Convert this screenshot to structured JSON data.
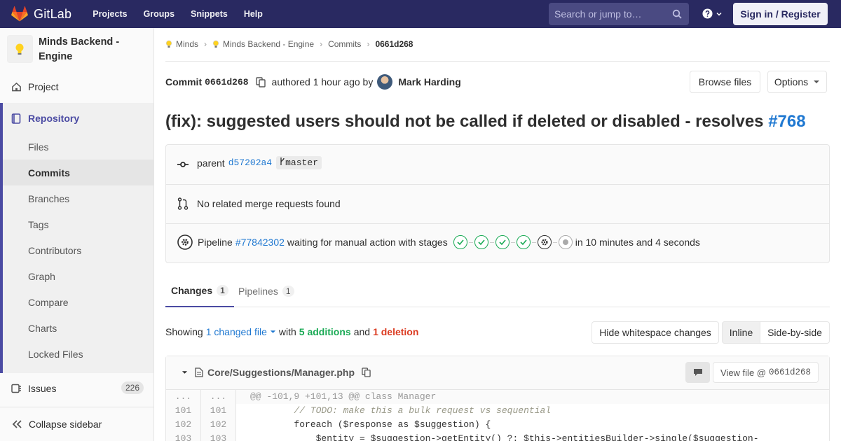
{
  "navbar": {
    "brand": "GitLab",
    "links": [
      "Projects",
      "Groups",
      "Snippets",
      "Help"
    ],
    "search_placeholder": "Search or jump to…",
    "signin_label": "Sign in / Register",
    "colors": {
      "bg": "#292961",
      "accent": "#fc6d26"
    }
  },
  "sidebar": {
    "project_name": "Minds Backend - Engine",
    "items": {
      "project": "Project",
      "repository": "Repository",
      "issues": "Issues",
      "issues_count": "226",
      "collapse": "Collapse sidebar"
    },
    "repository_sub": [
      "Files",
      "Commits",
      "Branches",
      "Tags",
      "Contributors",
      "Graph",
      "Compare",
      "Charts",
      "Locked Files"
    ],
    "active_sub": "Commits"
  },
  "breadcrumb": [
    "Minds",
    "Minds Backend - Engine",
    "Commits",
    "0661d268"
  ],
  "commit": {
    "label": "Commit",
    "short_sha": "0661d268",
    "authored": "authored 1 hour ago by",
    "author": "Mark Harding",
    "browse_files": "Browse files",
    "options": "Options",
    "title": "(fix): suggested users should not be called if deleted or disabled - resolves",
    "issue_ref": "#768",
    "parent_label": "parent",
    "parent_sha": "d57202a4",
    "branch": "master",
    "merge_requests": "No related merge requests found",
    "pipeline": {
      "label": "Pipeline",
      "id": "#77842302",
      "status_text": "waiting for manual action with stages",
      "duration": "in 10 minutes and 4 seconds"
    }
  },
  "tabs": [
    {
      "label": "Changes",
      "count": "1"
    },
    {
      "label": "Pipelines",
      "count": "1"
    }
  ],
  "diff_summary": {
    "showing": "Showing",
    "changed_files": "1 changed file",
    "with": "with",
    "additions": "5 additions",
    "and": "and",
    "deletions": "1 deletion",
    "hide_whitespace": "Hide whitespace changes",
    "inline": "Inline",
    "side_by_side": "Side-by-side"
  },
  "file": {
    "path": "Core/Suggestions/Manager.php",
    "view_file": "View file @",
    "view_sha": "0661d268",
    "lines": [
      {
        "old": "...",
        "new": "...",
        "text": "@@ -101,9 +101,13 @@ class Manager"
      },
      {
        "old": "101",
        "new": "101",
        "text": "        // TODO: make this a bulk request vs sequential"
      },
      {
        "old": "102",
        "new": "102",
        "text": "        foreach ($response as $suggestion) {"
      },
      {
        "old": "103",
        "new": "103",
        "text": "            $entity = $suggestion->getEntity() ?: $this->entitiesBuilder->single($suggestion-"
      }
    ]
  }
}
